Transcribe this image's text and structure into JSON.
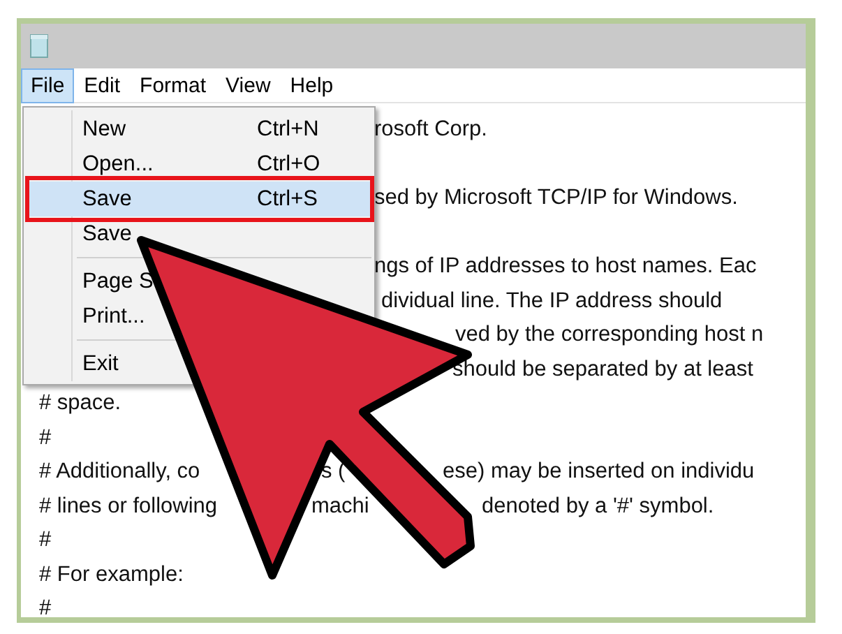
{
  "menu_bar": [
    {
      "label": "File",
      "selected": true
    },
    {
      "label": "Edit",
      "selected": false
    },
    {
      "label": "Format",
      "selected": false
    },
    {
      "label": "View",
      "selected": false
    },
    {
      "label": "Help",
      "selected": false
    }
  ],
  "file_menu": [
    {
      "kind": "item",
      "label": "New",
      "shortcut": "Ctrl+N",
      "selected": false
    },
    {
      "kind": "item",
      "label": "Open...",
      "shortcut": "Ctrl+O",
      "selected": false
    },
    {
      "kind": "item",
      "label": "Save",
      "shortcut": "Ctrl+S",
      "selected": true
    },
    {
      "kind": "item",
      "label": "Save",
      "selected": false
    },
    {
      "kind": "separator"
    },
    {
      "kind": "item",
      "label": "Page S",
      "selected": false
    },
    {
      "kind": "item",
      "label": "Print...",
      "selected": false
    },
    {
      "kind": "separator"
    },
    {
      "kind": "item",
      "label": "Exit",
      "selected": false
    }
  ],
  "document_lines": [
    [
      "rosoft Corp."
    ],
    [
      "sed by Microsoft TCP/IP for Windows."
    ],
    [
      "ngs of IP addresses to host names. Eac"
    ],
    [
      "dividual line. The IP address should"
    ],
    [
      "ved by the corresponding host n"
    ],
    [
      "should be separated by at least"
    ],
    [
      "# space."
    ],
    [
      "#"
    ],
    [
      "# Additionally, co",
      "s (",
      "ese) may be inserted on individu"
    ],
    [
      "# lines or following",
      "machi",
      "denoted by a '#' symbol."
    ],
    [
      "#"
    ],
    [
      "# For example:"
    ],
    [
      "#"
    ]
  ]
}
